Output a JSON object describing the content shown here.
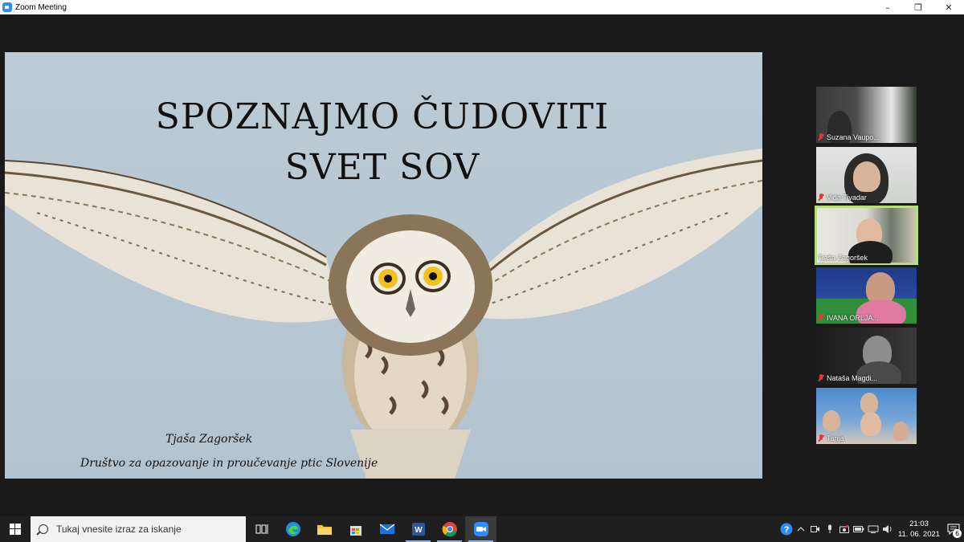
{
  "window": {
    "title": "Zoom Meeting",
    "minimize": "–",
    "maximize": "❐",
    "close": "✕"
  },
  "slide": {
    "title_line1": "SPOZNAJMO ČUDOVITI",
    "title_line2": "SVET SOV",
    "author": "Tjaša Zagoršek",
    "organization": "Društvo za opazovanje in proučevanje ptic Slovenije"
  },
  "participants": [
    {
      "name": "Suzana Vaupo...",
      "muted": true,
      "active": false
    },
    {
      "name": "Vida Tivadar",
      "muted": true,
      "active": false
    },
    {
      "name": "Tjaša Zagoršek",
      "muted": false,
      "active": true
    },
    {
      "name": "IVANA ORLJA...",
      "muted": true,
      "active": false
    },
    {
      "name": "Nataša Magdi...",
      "muted": true,
      "active": false
    },
    {
      "name": "Tanja",
      "muted": true,
      "active": false
    }
  ],
  "taskbar": {
    "search_placeholder": "Tukaj vnesite izraz za iskanje",
    "apps": [
      "task-view",
      "edge",
      "file-explorer",
      "store",
      "mail",
      "word",
      "chrome",
      "zoom"
    ],
    "time": "21:03",
    "date": "11. 06. 2021",
    "notification_count": "6"
  },
  "colors": {
    "active_speaker": "#b8e07a",
    "zoom_blue": "#2d8cff",
    "muted_red": "#e53935"
  }
}
